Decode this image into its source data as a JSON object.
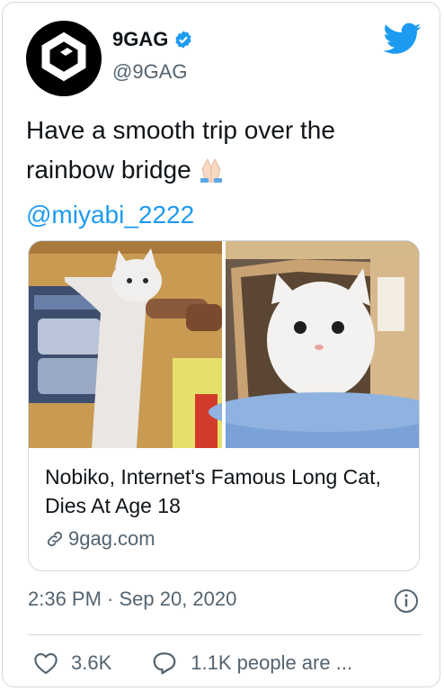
{
  "author": {
    "name": "9GAG",
    "handle": "@9GAG",
    "verified": true,
    "avatar_icon": "9gag-logo-icon"
  },
  "tweet": {
    "text": "Have a smooth trip over the rainbow bridge",
    "emoji": "🙏🏻",
    "mention": "@miyabi_2222"
  },
  "link_card": {
    "title": "Nobiko, Internet's Famous Long Cat, Dies At Age 18",
    "domain": "9gag.com"
  },
  "timestamp": "2:36 PM · Sep 20, 2020",
  "actions": {
    "likes": "3.6K",
    "replies": "1.1K people are ..."
  },
  "colors": {
    "accent": "#1d9bf0",
    "secondary_text": "#536471",
    "border": "#cfd9de"
  }
}
